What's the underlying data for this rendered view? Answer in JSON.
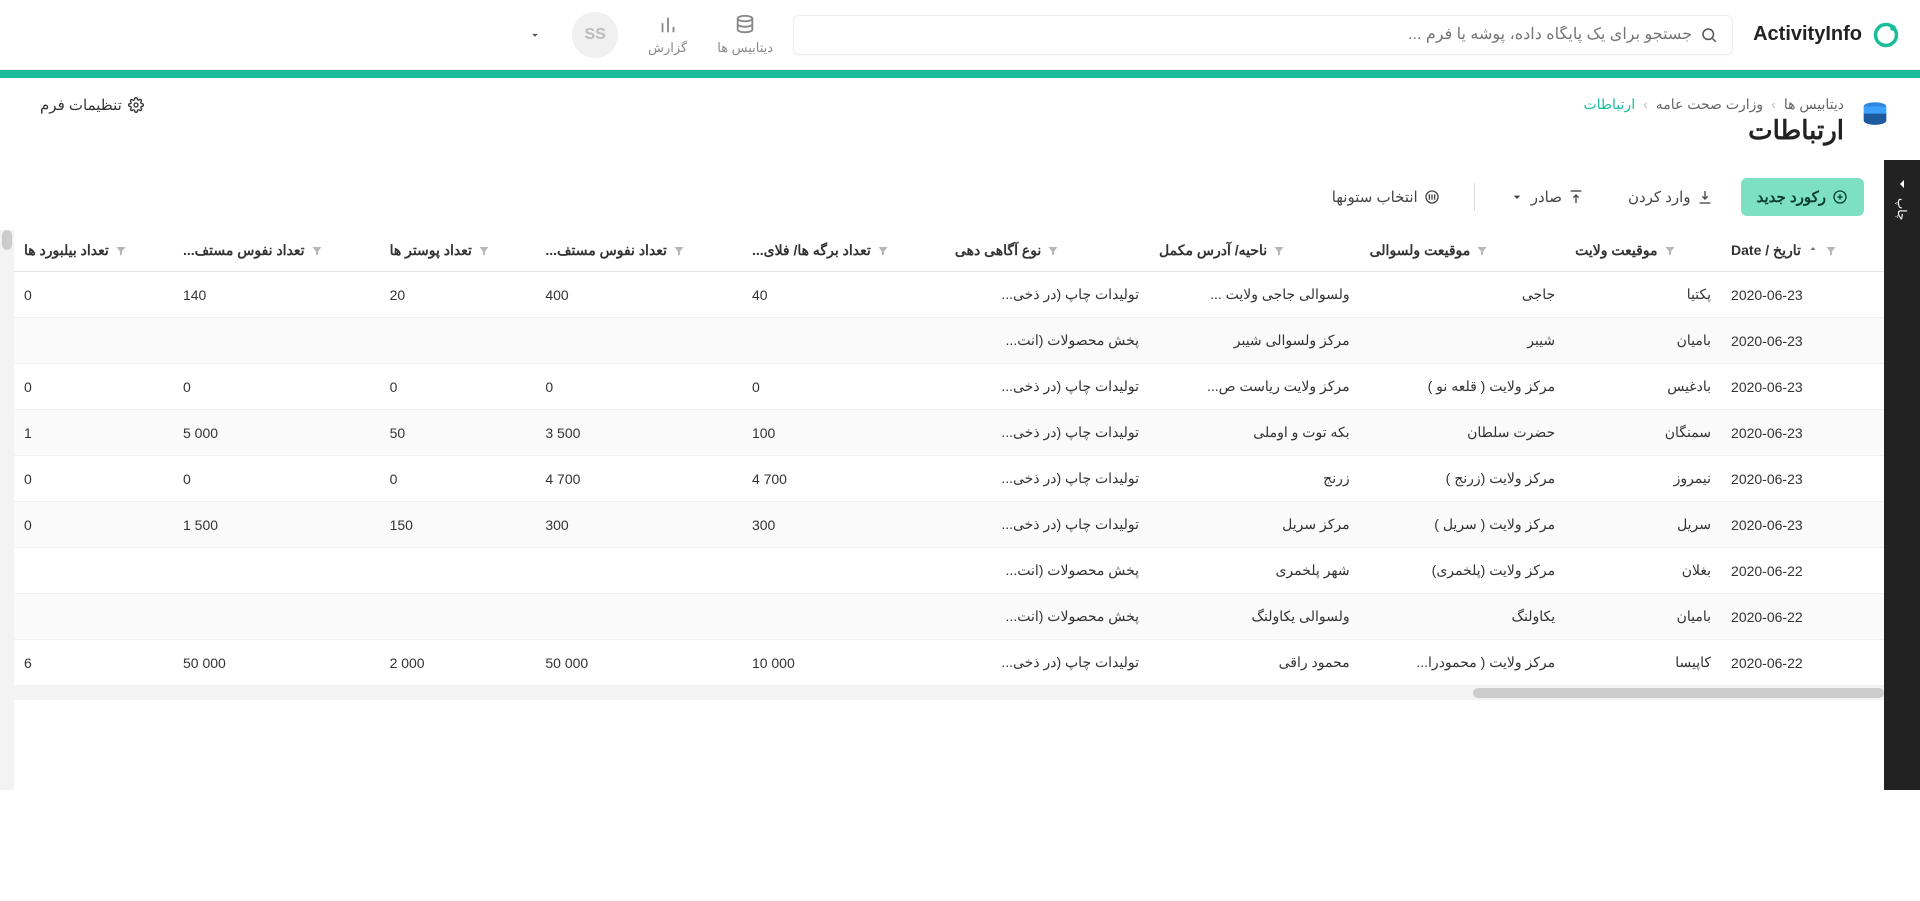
{
  "brand": {
    "name": "ActivityInfo"
  },
  "search": {
    "placeholder": "جستجو برای یک پایگاه داده، پوشه یا فرم ..."
  },
  "nav": {
    "databases": "دیتابیس ها",
    "reports": "گزارش"
  },
  "avatar": {
    "initials": "SS"
  },
  "breadcrumb": {
    "root": "دیتابیس ها",
    "db": "وزارت صحت عامه",
    "form": "ارتباطات"
  },
  "page": {
    "title": "ارتباطات",
    "form_settings": "تنظیمات فرم"
  },
  "side": {
    "label": "چاپ"
  },
  "toolbar": {
    "new_record": "رکورد جدید",
    "import": "وارد کردن",
    "export": "صادر",
    "columns": "انتخاب ستونها"
  },
  "columns": [
    {
      "key": "date",
      "label": "تاریخ / Date",
      "sorted": true
    },
    {
      "key": "province",
      "label": "موقیعت ولایت"
    },
    {
      "key": "district",
      "label": "موقیعت ولسوالی"
    },
    {
      "key": "address",
      "label": "ناحیه/ آدرس مکمل"
    },
    {
      "key": "awareness",
      "label": "نوع آگاهی دهی"
    },
    {
      "key": "flyers",
      "label": "تعداد برگه ها/ فلای..."
    },
    {
      "key": "pop_flyers",
      "label": "تعداد نفوس مستف..."
    },
    {
      "key": "posters",
      "label": "تعداد پوستر ها"
    },
    {
      "key": "pop_posters",
      "label": "تعداد نفوس مستف..."
    },
    {
      "key": "billboards",
      "label": "تعداد بیلبورد ها"
    }
  ],
  "rows": [
    {
      "date": "2020-06-23",
      "province": "پکتیا",
      "district": "جاجی",
      "address": "ولسوالی جاجی ولایت ...",
      "awareness": "تولیدات چاپ (در ذخی...",
      "flyers": "40",
      "pop_flyers": "400",
      "posters": "20",
      "pop_posters": "140",
      "billboards": "0"
    },
    {
      "date": "2020-06-23",
      "province": "بامیان",
      "district": "شیبر",
      "address": "مرکز ولسوالی شیبر",
      "awareness": "پخش محصولات (انت...",
      "flyers": "",
      "pop_flyers": "",
      "posters": "",
      "pop_posters": "",
      "billboards": ""
    },
    {
      "date": "2020-06-23",
      "province": "بادغیس",
      "district": "مرکز ولایت ( قلعه نو )",
      "address": "مرکز ولایت ریاست ص...",
      "awareness": "تولیدات چاپ (در ذخی...",
      "flyers": "0",
      "pop_flyers": "0",
      "posters": "0",
      "pop_posters": "0",
      "billboards": "0"
    },
    {
      "date": "2020-06-23",
      "province": "سمنگان",
      "district": "حضرت سلطان",
      "address": "بکه توت و اوملی",
      "awareness": "تولیدات چاپ (در ذخی...",
      "flyers": "100",
      "pop_flyers": "3 500",
      "posters": "50",
      "pop_posters": "5 000",
      "billboards": "1"
    },
    {
      "date": "2020-06-23",
      "province": "نیمروز",
      "district": "مرکز ولایت (زرنج )",
      "address": "زرنج",
      "awareness": "تولیدات چاپ (در ذخی...",
      "flyers": "4 700",
      "pop_flyers": "4 700",
      "posters": "0",
      "pop_posters": "0",
      "billboards": "0"
    },
    {
      "date": "2020-06-23",
      "province": "سریل",
      "district": "مرکز ولایت ( سریل )",
      "address": "مرکز سریل",
      "awareness": "تولیدات چاپ (در ذخی...",
      "flyers": "300",
      "pop_flyers": "300",
      "posters": "150",
      "pop_posters": "1 500",
      "billboards": "0"
    },
    {
      "date": "2020-06-22",
      "province": "بغلان",
      "district": "مرکز ولایت (پلخمری)",
      "address": "شهر پلخمری",
      "awareness": "پخش محصولات (انت...",
      "flyers": "",
      "pop_flyers": "",
      "posters": "",
      "pop_posters": "",
      "billboards": ""
    },
    {
      "date": "2020-06-22",
      "province": "بامیان",
      "district": "یکاولنگ",
      "address": "ولسوالی یکاولنگ",
      "awareness": "پخش محصولات (انت...",
      "flyers": "",
      "pop_flyers": "",
      "posters": "",
      "pop_posters": "",
      "billboards": ""
    },
    {
      "date": "2020-06-22",
      "province": "کاپیسا",
      "district": "مرکز ولایت ( محمودرا...",
      "address": "محمود راقی",
      "awareness": "تولیدات چاپ (در ذخی...",
      "flyers": "10 000",
      "pop_flyers": "50 000",
      "posters": "2 000",
      "pop_posters": "50 000",
      "billboards": "6"
    }
  ]
}
